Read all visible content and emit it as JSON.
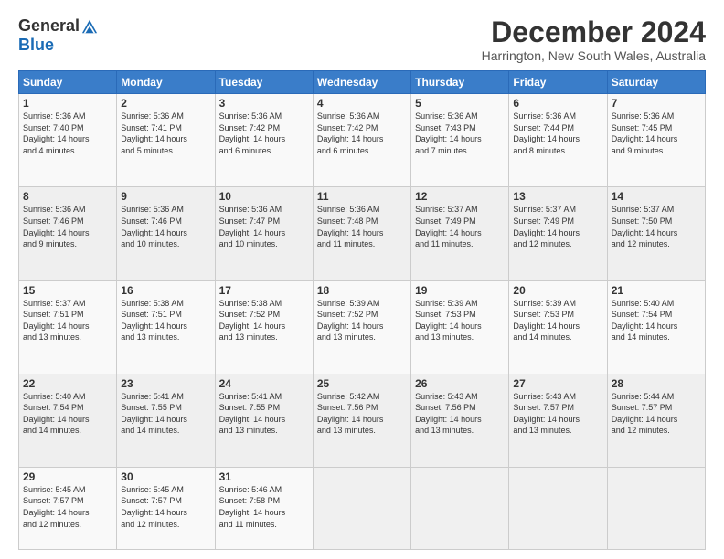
{
  "logo": {
    "general": "General",
    "blue": "Blue"
  },
  "header": {
    "month": "December 2024",
    "location": "Harrington, New South Wales, Australia"
  },
  "weekdays": [
    "Sunday",
    "Monday",
    "Tuesday",
    "Wednesday",
    "Thursday",
    "Friday",
    "Saturday"
  ],
  "weeks": [
    [
      {
        "day": "1",
        "lines": [
          "Sunrise: 5:36 AM",
          "Sunset: 7:40 PM",
          "Daylight: 14 hours",
          "and 4 minutes."
        ]
      },
      {
        "day": "2",
        "lines": [
          "Sunrise: 5:36 AM",
          "Sunset: 7:41 PM",
          "Daylight: 14 hours",
          "and 5 minutes."
        ]
      },
      {
        "day": "3",
        "lines": [
          "Sunrise: 5:36 AM",
          "Sunset: 7:42 PM",
          "Daylight: 14 hours",
          "and 6 minutes."
        ]
      },
      {
        "day": "4",
        "lines": [
          "Sunrise: 5:36 AM",
          "Sunset: 7:42 PM",
          "Daylight: 14 hours",
          "and 6 minutes."
        ]
      },
      {
        "day": "5",
        "lines": [
          "Sunrise: 5:36 AM",
          "Sunset: 7:43 PM",
          "Daylight: 14 hours",
          "and 7 minutes."
        ]
      },
      {
        "day": "6",
        "lines": [
          "Sunrise: 5:36 AM",
          "Sunset: 7:44 PM",
          "Daylight: 14 hours",
          "and 8 minutes."
        ]
      },
      {
        "day": "7",
        "lines": [
          "Sunrise: 5:36 AM",
          "Sunset: 7:45 PM",
          "Daylight: 14 hours",
          "and 9 minutes."
        ]
      }
    ],
    [
      {
        "day": "8",
        "lines": [
          "Sunrise: 5:36 AM",
          "Sunset: 7:46 PM",
          "Daylight: 14 hours",
          "and 9 minutes."
        ]
      },
      {
        "day": "9",
        "lines": [
          "Sunrise: 5:36 AM",
          "Sunset: 7:46 PM",
          "Daylight: 14 hours",
          "and 10 minutes."
        ]
      },
      {
        "day": "10",
        "lines": [
          "Sunrise: 5:36 AM",
          "Sunset: 7:47 PM",
          "Daylight: 14 hours",
          "and 10 minutes."
        ]
      },
      {
        "day": "11",
        "lines": [
          "Sunrise: 5:36 AM",
          "Sunset: 7:48 PM",
          "Daylight: 14 hours",
          "and 11 minutes."
        ]
      },
      {
        "day": "12",
        "lines": [
          "Sunrise: 5:37 AM",
          "Sunset: 7:49 PM",
          "Daylight: 14 hours",
          "and 11 minutes."
        ]
      },
      {
        "day": "13",
        "lines": [
          "Sunrise: 5:37 AM",
          "Sunset: 7:49 PM",
          "Daylight: 14 hours",
          "and 12 minutes."
        ]
      },
      {
        "day": "14",
        "lines": [
          "Sunrise: 5:37 AM",
          "Sunset: 7:50 PM",
          "Daylight: 14 hours",
          "and 12 minutes."
        ]
      }
    ],
    [
      {
        "day": "15",
        "lines": [
          "Sunrise: 5:37 AM",
          "Sunset: 7:51 PM",
          "Daylight: 14 hours",
          "and 13 minutes."
        ]
      },
      {
        "day": "16",
        "lines": [
          "Sunrise: 5:38 AM",
          "Sunset: 7:51 PM",
          "Daylight: 14 hours",
          "and 13 minutes."
        ]
      },
      {
        "day": "17",
        "lines": [
          "Sunrise: 5:38 AM",
          "Sunset: 7:52 PM",
          "Daylight: 14 hours",
          "and 13 minutes."
        ]
      },
      {
        "day": "18",
        "lines": [
          "Sunrise: 5:39 AM",
          "Sunset: 7:52 PM",
          "Daylight: 14 hours",
          "and 13 minutes."
        ]
      },
      {
        "day": "19",
        "lines": [
          "Sunrise: 5:39 AM",
          "Sunset: 7:53 PM",
          "Daylight: 14 hours",
          "and 13 minutes."
        ]
      },
      {
        "day": "20",
        "lines": [
          "Sunrise: 5:39 AM",
          "Sunset: 7:53 PM",
          "Daylight: 14 hours",
          "and 14 minutes."
        ]
      },
      {
        "day": "21",
        "lines": [
          "Sunrise: 5:40 AM",
          "Sunset: 7:54 PM",
          "Daylight: 14 hours",
          "and 14 minutes."
        ]
      }
    ],
    [
      {
        "day": "22",
        "lines": [
          "Sunrise: 5:40 AM",
          "Sunset: 7:54 PM",
          "Daylight: 14 hours",
          "and 14 minutes."
        ]
      },
      {
        "day": "23",
        "lines": [
          "Sunrise: 5:41 AM",
          "Sunset: 7:55 PM",
          "Daylight: 14 hours",
          "and 14 minutes."
        ]
      },
      {
        "day": "24",
        "lines": [
          "Sunrise: 5:41 AM",
          "Sunset: 7:55 PM",
          "Daylight: 14 hours",
          "and 13 minutes."
        ]
      },
      {
        "day": "25",
        "lines": [
          "Sunrise: 5:42 AM",
          "Sunset: 7:56 PM",
          "Daylight: 14 hours",
          "and 13 minutes."
        ]
      },
      {
        "day": "26",
        "lines": [
          "Sunrise: 5:43 AM",
          "Sunset: 7:56 PM",
          "Daylight: 14 hours",
          "and 13 minutes."
        ]
      },
      {
        "day": "27",
        "lines": [
          "Sunrise: 5:43 AM",
          "Sunset: 7:57 PM",
          "Daylight: 14 hours",
          "and 13 minutes."
        ]
      },
      {
        "day": "28",
        "lines": [
          "Sunrise: 5:44 AM",
          "Sunset: 7:57 PM",
          "Daylight: 14 hours",
          "and 12 minutes."
        ]
      }
    ],
    [
      {
        "day": "29",
        "lines": [
          "Sunrise: 5:45 AM",
          "Sunset: 7:57 PM",
          "Daylight: 14 hours",
          "and 12 minutes."
        ]
      },
      {
        "day": "30",
        "lines": [
          "Sunrise: 5:45 AM",
          "Sunset: 7:57 PM",
          "Daylight: 14 hours",
          "and 12 minutes."
        ]
      },
      {
        "day": "31",
        "lines": [
          "Sunrise: 5:46 AM",
          "Sunset: 7:58 PM",
          "Daylight: 14 hours",
          "and 11 minutes."
        ]
      },
      {
        "day": "",
        "lines": []
      },
      {
        "day": "",
        "lines": []
      },
      {
        "day": "",
        "lines": []
      },
      {
        "day": "",
        "lines": []
      }
    ]
  ]
}
